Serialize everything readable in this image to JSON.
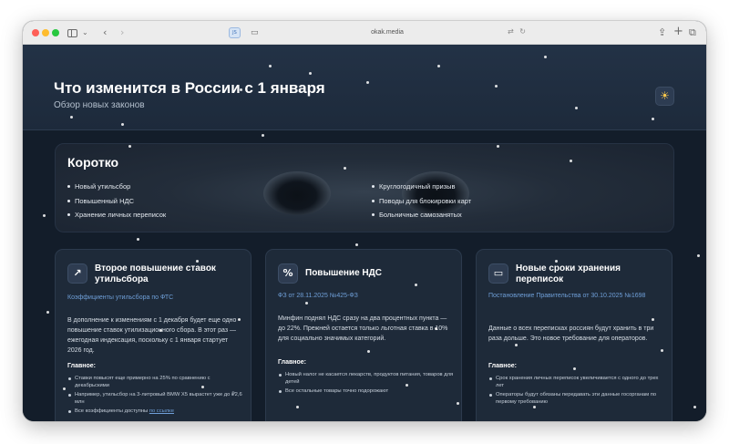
{
  "browser": {
    "url": "okak.media",
    "sidebar_icon": "sidebar-icon",
    "back_icon": "chevron-left-icon",
    "forward_icon": "chevron-right-icon",
    "tab_chip": "JS"
  },
  "header": {
    "title": "Что изменится в России с 1 января",
    "subtitle": "Обзор новых законов",
    "theme_icon": "sun-icon"
  },
  "brief": {
    "title": "Коротко",
    "col1": [
      "Новый утильсбор",
      "Повышенный НДС",
      "Хранение личных переписок"
    ],
    "col2": [
      "Круглогодичный призыв",
      "Поводы для блокировки карт",
      "Больничные самозанятых"
    ]
  },
  "cards": [
    {
      "icon": "trending-up-icon",
      "title": "Второе повышение ставок утильсбора",
      "source": "Коэффициенты утильсбора по ФТС",
      "body": "В дополнение к изменениям с 1 декабря будет еще одно повышение ставок утилизационного сбора. В этот раз — ежегодная индексация, поскольку с 1 января стартует 2026 год.",
      "main_label": "Главное:",
      "points": [
        "Ставки повысят еще примерно на 25% по сравнению с декабрьскими",
        "Например, утильсбор на 3-литровый BMW X5 вырастет уже до ₽2,6 млн"
      ],
      "last_point_prefix": "Все коэффициенты доступны ",
      "last_point_link": "по ссылке"
    },
    {
      "icon": "percent-icon",
      "title": "Повышение НДС",
      "source": "ФЗ от 28.11.2025 №425-ФЗ",
      "body": "Минфин поднял НДС сразу на два процентных пункта — до 22%. Прежней остается только льготная ставка в 10% для социально значимых категорий.",
      "main_label": "Главное:",
      "points": [
        "Новый налог не касается лекарств, продуктов питания, товаров для детей",
        "Все остальные товары точно подорожают"
      ]
    },
    {
      "icon": "message-icon",
      "title": "Новые сроки хранения переписок",
      "source": "Постановление Правительства от 30.10.2025 №1698",
      "body": "Данные о всех переписках россиян будут хранить в три раза дольше. Это новое требование для операторов.",
      "main_label": "Главное:",
      "points": [
        "Срок хранения личных переписок увеличивается с одного до трех лет",
        "Операторы будут обязаны передавать эти данные госорганам по первому требованию"
      ]
    }
  ]
}
